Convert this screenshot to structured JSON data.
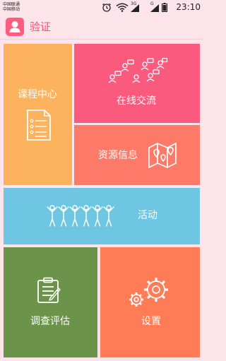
{
  "status_bar": {
    "carrier_1": "中国联通",
    "carrier_2": "中国移动",
    "network_1": "3G",
    "network_2": "G",
    "time": "23:10"
  },
  "header": {
    "title": "验证",
    "icon": "user-icon"
  },
  "tiles": {
    "course": {
      "label": "课程中心",
      "icon": "document-list-icon",
      "color": "#fdb35e"
    },
    "chat": {
      "label": "在线交流",
      "icon": "user-chat-icon",
      "color": "#fa5a7d"
    },
    "resources": {
      "label": "资源信息",
      "icon": "map-pins-icon",
      "color": "#fc7a67"
    },
    "activity": {
      "label": "活动",
      "icon": "people-group-icon",
      "color": "#6ec6e2"
    },
    "survey": {
      "label": "调查评估",
      "icon": "clipboard-icon",
      "color": "#6b944a"
    },
    "settings": {
      "label": "设置",
      "icon": "gears-icon",
      "color": "#ff7c57"
    }
  }
}
